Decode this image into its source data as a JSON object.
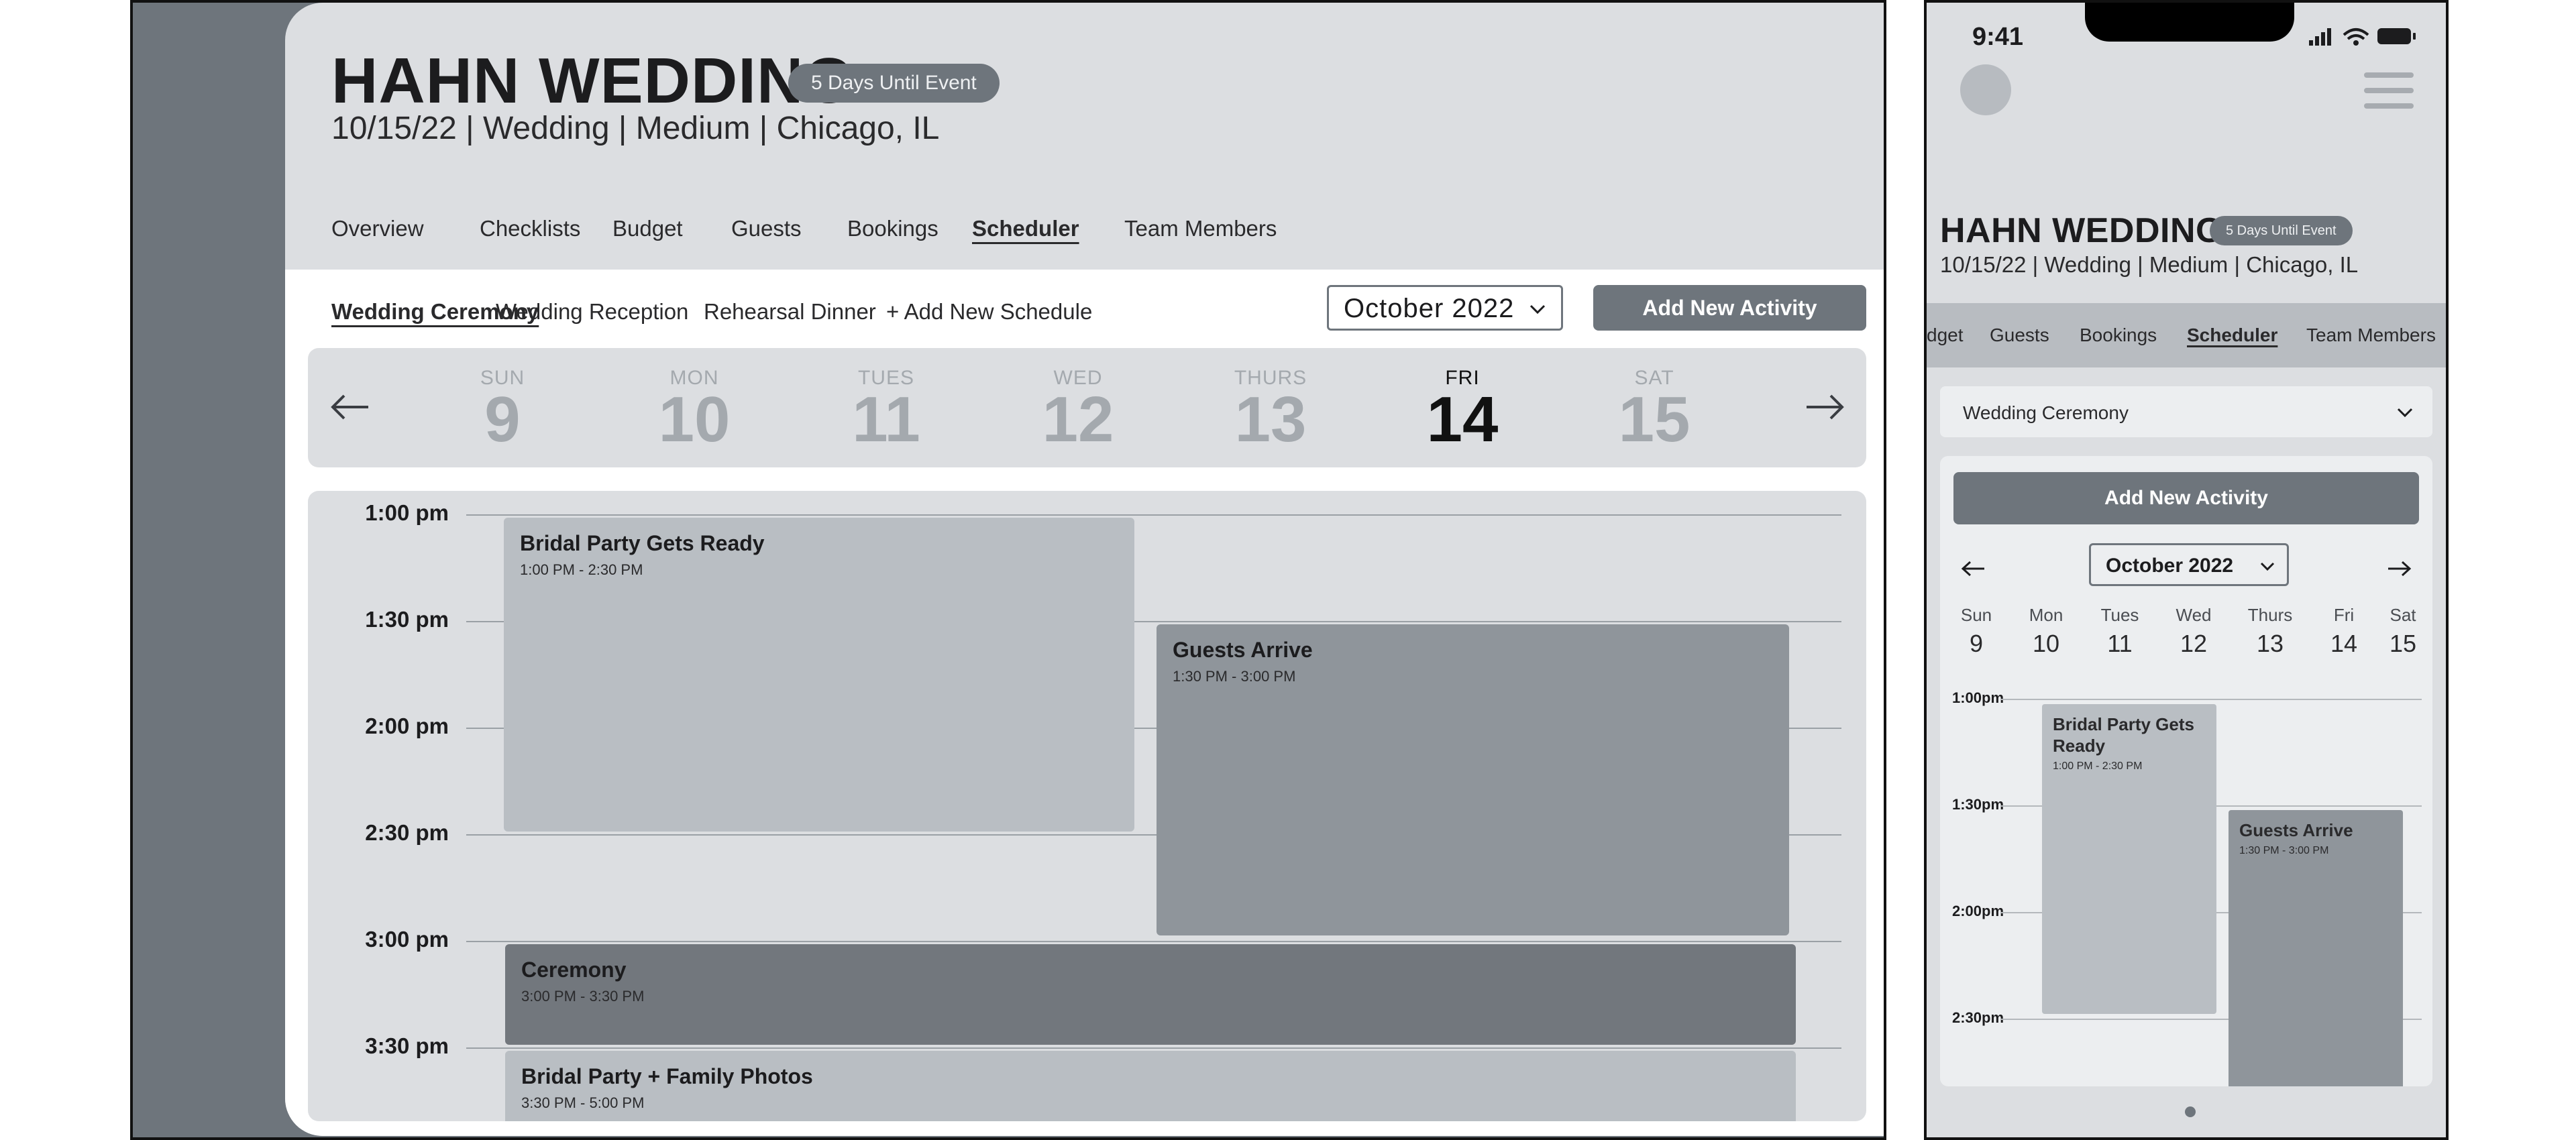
{
  "desktop": {
    "event_title": "HAHN WEDDING",
    "days_badge": "5 Days Until Event",
    "event_meta": "10/15/22 | Wedding | Medium | Chicago, IL",
    "nav_tabs": [
      "Overview",
      "Checklists",
      "Budget",
      "Guests",
      "Bookings",
      "Scheduler",
      "Team Members"
    ],
    "active_nav_tab": "Scheduler",
    "schedule_tabs": [
      "Wedding Ceremony",
      "Wedding Reception",
      "Rehearsal Dinner",
      "+ Add New Schedule"
    ],
    "active_schedule_tab": "Wedding Ceremony",
    "month_select": "October  2022",
    "add_button": "Add New Activity",
    "week_days": [
      {
        "name": "SUN",
        "date": "9"
      },
      {
        "name": "MON",
        "date": "10"
      },
      {
        "name": "TUES",
        "date": "11"
      },
      {
        "name": "WED",
        "date": "12"
      },
      {
        "name": "THURS",
        "date": "13"
      },
      {
        "name": "FRI",
        "date": "14"
      },
      {
        "name": "SAT",
        "date": "15"
      }
    ],
    "today_index": 5,
    "time_slots": [
      "1:00 pm",
      "1:30 pm",
      "2:00 pm",
      "2:30 pm",
      "3:00 pm",
      "3:30 pm"
    ],
    "events": [
      {
        "title": "Bridal Party Gets Ready",
        "time": "1:00 PM - 2:30 PM"
      },
      {
        "title": "Guests Arrive",
        "time": "1:30 PM - 3:00 PM"
      },
      {
        "title": "Ceremony",
        "time": "3:00 PM - 3:30 PM"
      },
      {
        "title": "Bridal Party + Family Photos",
        "time": "3:30 PM - 5:00 PM"
      }
    ]
  },
  "mobile": {
    "status_time": "9:41",
    "event_title": "HAHN WEDDING",
    "days_badge": "5 Days Until Event",
    "event_meta": "10/15/22 | Wedding | Medium | Chicago, IL",
    "tabs": [
      "dget",
      "Guests",
      "Bookings",
      "Scheduler",
      "Team Members"
    ],
    "active_tab": "Scheduler",
    "schedule_select": "Wedding Ceremony",
    "add_button": "Add New Activity",
    "month_select": "October 2022",
    "week_days": [
      {
        "name": "Sun",
        "date": "9"
      },
      {
        "name": "Mon",
        "date": "10"
      },
      {
        "name": "Tues",
        "date": "11"
      },
      {
        "name": "Wed",
        "date": "12"
      },
      {
        "name": "Thurs",
        "date": "13"
      },
      {
        "name": "Fri",
        "date": "14"
      },
      {
        "name": "Sat",
        "date": "15"
      }
    ],
    "time_slots": [
      "1:00pm",
      "1:30pm",
      "2:00pm",
      "2:30pm"
    ],
    "events": [
      {
        "title": "Bridal Party Gets Ready",
        "time": "1:00 PM - 2:30 PM"
      },
      {
        "title": "Guests Arrive",
        "time": "1:30 PM - 3:00 PM"
      }
    ]
  },
  "colors": {
    "accent_gray": "#6e757c",
    "panel_bg": "#dcdee1",
    "event_light": "#b9bec3",
    "event_mid": "#8f959b",
    "event_dark": "#72777d"
  }
}
